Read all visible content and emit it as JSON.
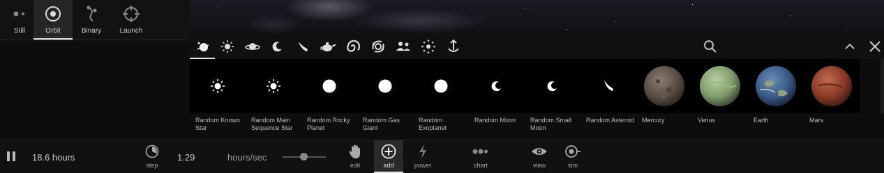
{
  "modes": [
    {
      "label": "Still",
      "icon": "dots-icon"
    },
    {
      "label": "Orbit",
      "icon": "orbit-icon"
    },
    {
      "label": "Binary",
      "icon": "binary-icon"
    },
    {
      "label": "Launch",
      "icon": "crosshair-icon"
    }
  ],
  "active_mode": "Orbit",
  "categories": [
    "star-planet-icon",
    "sun-icon",
    "ringed-planet-icon",
    "moon-icon",
    "comet-icon",
    "teapot-icon",
    "galaxy-icon",
    "black-hole-icon",
    "people-icon",
    "ring-dots-icon",
    "anchor-icon"
  ],
  "items": [
    {
      "label": "Random Known Star",
      "thumb": "star"
    },
    {
      "label": "Random Main Sequence Star",
      "thumb": "star"
    },
    {
      "label": "Random Rocky Planet",
      "thumb": "disc"
    },
    {
      "label": "Random Gas Giant",
      "thumb": "disc"
    },
    {
      "label": "Random Exoplanet",
      "thumb": "disc"
    },
    {
      "label": "Random Moon",
      "thumb": "crescent"
    },
    {
      "label": "Random Small Moon",
      "thumb": "crescent"
    },
    {
      "label": "Random Asteroid",
      "thumb": "comet"
    },
    {
      "label": "Mercury",
      "thumb": "mercury"
    },
    {
      "label": "Venus",
      "thumb": "venus"
    },
    {
      "label": "Earth",
      "thumb": "earth"
    },
    {
      "label": "Mars",
      "thumb": "mars"
    }
  ],
  "status": {
    "elapsed": "18.6 hours",
    "rate": "1.29",
    "rate_unit": "hours/sec"
  },
  "toolbar": [
    {
      "label": "step",
      "icon": "step-icon"
    },
    {
      "label": "edit",
      "icon": "hand-icon"
    },
    {
      "label": "add",
      "icon": "add-icon"
    },
    {
      "label": "power",
      "icon": "power-icon"
    },
    {
      "label": "chart",
      "icon": "chart-icon"
    },
    {
      "label": "view",
      "icon": "eye-icon"
    },
    {
      "label": "sim",
      "icon": "sim-icon"
    }
  ],
  "active_tool": "add",
  "colors": {
    "background": "#0d0d0d",
    "active_underline": "#e6e6e6",
    "text": "#cfcfcf"
  }
}
